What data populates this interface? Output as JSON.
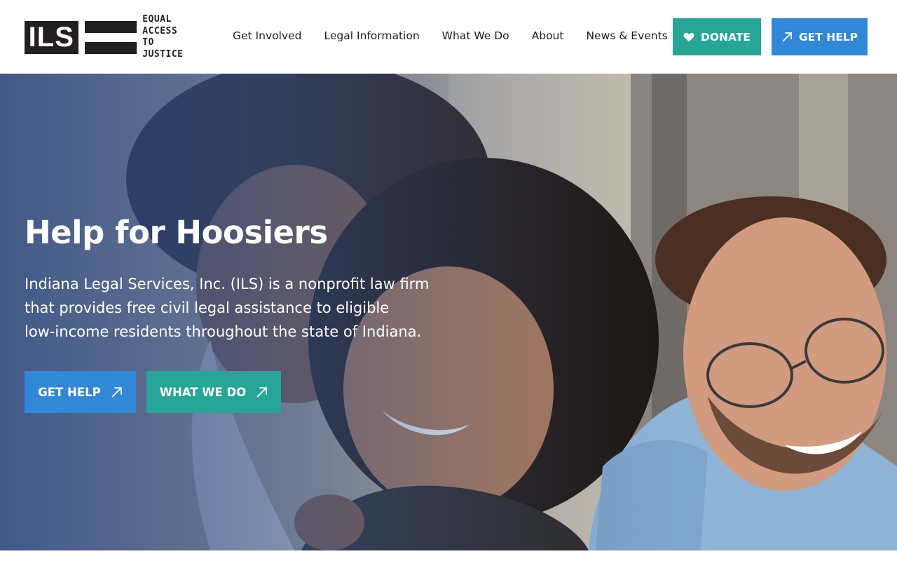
{
  "logo": {
    "mark": "ILS",
    "tagline": [
      "EQUAL",
      "ACCESS",
      "TO JUSTICE"
    ]
  },
  "nav": {
    "items": [
      {
        "label": "Get Involved"
      },
      {
        "label": "Legal Information"
      },
      {
        "label": "What We Do"
      },
      {
        "label": "About"
      },
      {
        "label": "News & Events"
      }
    ]
  },
  "header_actions": {
    "donate_label": "DONATE",
    "get_help_label": "GET HELP"
  },
  "hero": {
    "title": "Help for Hoosiers",
    "text_lines": [
      "Indiana Legal Services, Inc. (ILS) is a nonprofit law firm",
      "that provides free civil legal assistance to eligible",
      "low-income residents throughout the state of Indiana."
    ],
    "primary_button": "GET HELP",
    "secondary_button": "WHAT WE DO"
  },
  "colors": {
    "teal": "#27a596",
    "blue": "#3287d6",
    "logo_dark": "#231f20"
  },
  "icons": {
    "donate": "heart-icon",
    "get_help": "arrow-up-right-icon"
  }
}
